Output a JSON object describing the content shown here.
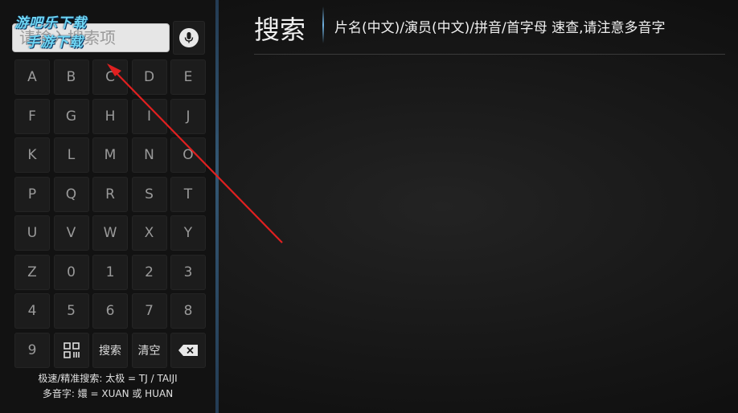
{
  "watermark": {
    "line1": "游吧乐下载",
    "line2": "手游下载"
  },
  "search": {
    "placeholder": "请输入搜索项",
    "value": ""
  },
  "keyboard": {
    "rows": [
      [
        "A",
        "B",
        "C",
        "D",
        "E"
      ],
      [
        "F",
        "G",
        "H",
        "I",
        "J"
      ],
      [
        "K",
        "L",
        "M",
        "N",
        "O"
      ],
      [
        "P",
        "Q",
        "R",
        "S",
        "T"
      ],
      [
        "U",
        "V",
        "W",
        "X",
        "Y"
      ],
      [
        "Z",
        "0",
        "1",
        "2",
        "3"
      ],
      [
        "4",
        "5",
        "6",
        "7",
        "8"
      ]
    ],
    "last_row": {
      "digit": "9",
      "search_label": "搜索",
      "clear_label": "清空"
    }
  },
  "hints": {
    "line1": "极速/精准搜索: 太极 = TJ / TAIJI",
    "line2": "多音字: 嬛 = XUAN 或 HUAN"
  },
  "main": {
    "title": "搜索",
    "subtitle": "片名(中文)/演员(中文)/拼音/首字母 速查,请注意多音字"
  },
  "colors": {
    "accent": "#6fb0e0",
    "arrow": "#e02020",
    "watermark": "#6fd7f5"
  }
}
